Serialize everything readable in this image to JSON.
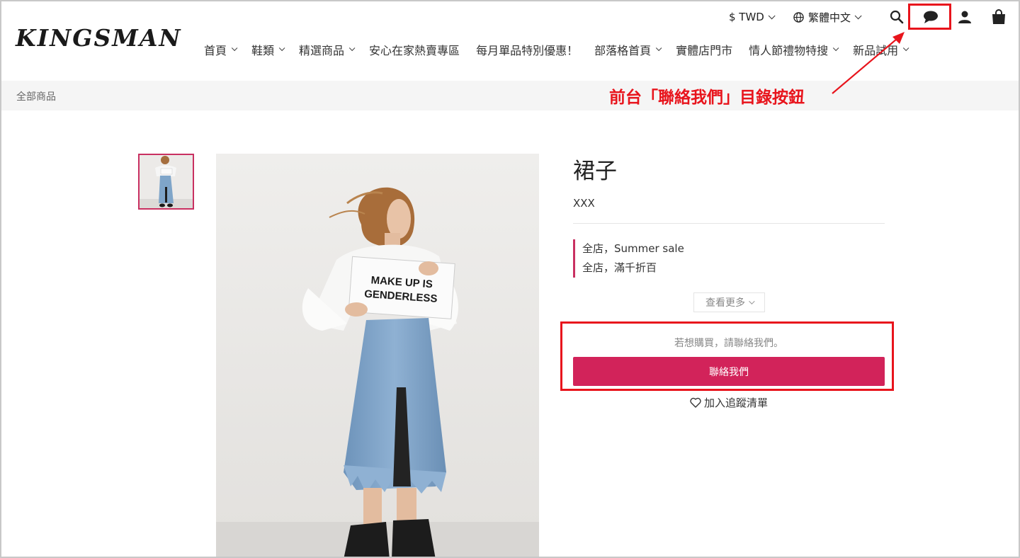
{
  "header": {
    "logo": "KINGSMAN",
    "currency": "$ TWD",
    "language": "繁體中文",
    "nav": [
      {
        "label": "首頁",
        "dropdown": true
      },
      {
        "label": "鞋類",
        "dropdown": true
      },
      {
        "label": "精選商品",
        "dropdown": true
      },
      {
        "label": "安心在家熱賣專區",
        "dropdown": false
      },
      {
        "label": "每月單品特別優惠！",
        "dropdown": false
      },
      {
        "label": "部落格首頁",
        "dropdown": true
      },
      {
        "label": "實體店門市",
        "dropdown": false
      },
      {
        "label": "情人節禮物特搜",
        "dropdown": true
      },
      {
        "label": "新品試用",
        "dropdown": true
      }
    ],
    "icons": [
      "search-icon",
      "chat-icon",
      "user-icon",
      "cart-icon"
    ]
  },
  "breadcrumb": "全部商品",
  "annotation": {
    "text": "前台「聯絡我們」目錄按鈕",
    "color": "#e8141c"
  },
  "product": {
    "title": "裙子",
    "subtitle": "XXX",
    "promotions": [
      "全店，Summer sale",
      "全店，滿千折百"
    ],
    "see_more": "查看更多",
    "contact_hint": "若想購買，請聯絡我們。",
    "contact_button": "聯絡我們",
    "wishlist": "加入追蹤清單",
    "sign_text_line1": "MAKE UP IS",
    "sign_text_line2": "GENDERLESS"
  },
  "colors": {
    "accent": "#d2235a",
    "annotation": "#e8141c"
  }
}
